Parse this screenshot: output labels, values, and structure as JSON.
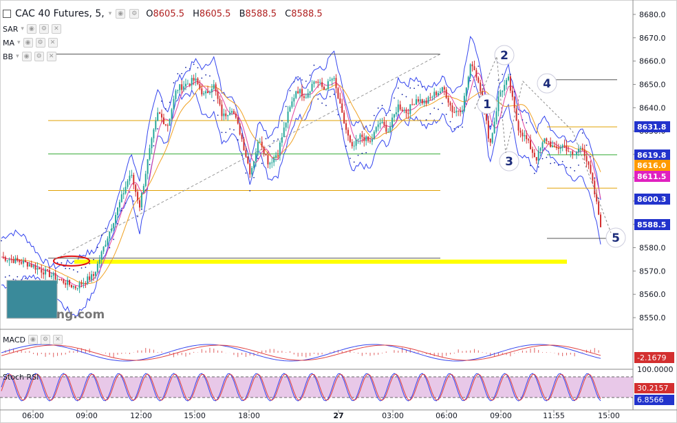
{
  "legend": {
    "title": "CAC 40 Futures, 5,",
    "o_label": "O",
    "o": "8605.5",
    "h_label": "H",
    "h": "8605.5",
    "l_label": "B",
    "l": "8588.5",
    "c_label": "C",
    "c": "8588.5"
  },
  "indicators": [
    "SAR",
    "MA",
    "BB"
  ],
  "panes": {
    "macd_label": "MACD",
    "stoch_label": "Stoch RSI"
  },
  "watermark": "ng.com",
  "colors": {
    "bull": "#26a69a",
    "bear": "#d32f2f",
    "bb": "#3344ee",
    "ma_fast": "#e040a0",
    "ma_slow": "#f0a020",
    "level_orange": "#e0a000",
    "level_green": "#33aa33",
    "highlight": "#ffff00",
    "stoch_fill": "#e8c8e8"
  },
  "chart_data": {
    "type": "candlestick",
    "title": "CAC 40 Futures, 5,",
    "ylim": [
      8545,
      8685
    ],
    "y_ticks": [
      8550.0,
      8560.0,
      8570.0,
      8580.0,
      8590.0,
      8600.0,
      8610.0,
      8620.0,
      8630.0,
      8640.0,
      8650.0,
      8660.0,
      8670.0,
      8680.0
    ],
    "x_ticks": [
      "06:00",
      "09:00",
      "12:00",
      "15:00",
      "18:00",
      "27",
      "03:00",
      "06:00",
      "09:00",
      "11:55",
      "15:00"
    ],
    "price_series": [
      [
        0,
        8576
      ],
      [
        3,
        8573
      ],
      [
        6,
        8567
      ],
      [
        8,
        8563
      ],
      [
        10,
        8568
      ],
      [
        12,
        8590
      ],
      [
        14,
        8612
      ],
      [
        15,
        8598
      ],
      [
        16,
        8620
      ],
      [
        17,
        8638
      ],
      [
        18,
        8632
      ],
      [
        19,
        8648
      ],
      [
        21,
        8652
      ],
      [
        22,
        8645
      ],
      [
        23,
        8650
      ],
      [
        24,
        8636
      ],
      [
        25,
        8640
      ],
      [
        26,
        8628
      ],
      [
        27,
        8612
      ],
      [
        28,
        8627
      ],
      [
        29,
        8616
      ],
      [
        30,
        8621
      ],
      [
        31,
        8636
      ],
      [
        32,
        8648
      ],
      [
        33,
        8645
      ],
      [
        34,
        8652
      ],
      [
        35,
        8648
      ],
      [
        36,
        8653
      ],
      [
        37,
        8636
      ],
      [
        38,
        8622
      ],
      [
        39,
        8628
      ],
      [
        40,
        8625
      ],
      [
        41,
        8634
      ],
      [
        42,
        8630
      ],
      [
        43,
        8641
      ],
      [
        44,
        8638
      ],
      [
        45,
        8644
      ],
      [
        46,
        8642
      ],
      [
        47,
        8646
      ],
      [
        48,
        8648
      ],
      [
        49,
        8638
      ],
      [
        50,
        8640
      ],
      [
        51,
        8660
      ],
      [
        52,
        8648
      ],
      [
        53,
        8624
      ],
      [
        54,
        8646
      ],
      [
        55,
        8652
      ],
      [
        56,
        8632
      ],
      [
        57,
        8626
      ],
      [
        58,
        8618
      ],
      [
        59,
        8627
      ],
      [
        60,
        8622
      ],
      [
        61,
        8624
      ],
      [
        62,
        8619
      ],
      [
        63,
        8624
      ],
      [
        64,
        8610
      ],
      [
        65,
        8590
      ]
    ],
    "levels_orange": [
      8634.5,
      8604.5,
      8631.8,
      8605.5
    ],
    "levels_green": [
      8620.2,
      8619.8
    ],
    "support_zone": 8574.0,
    "wave_labels": [
      "1",
      "2",
      "3",
      "4",
      "5"
    ],
    "price_labels": [
      {
        "value": "8631.8",
        "color": "#2233cc"
      },
      {
        "value": "8619.8",
        "color": "#2233cc"
      },
      {
        "value": "8616.0",
        "color": "#ff9a00"
      },
      {
        "value": "8611.5",
        "color": "#e020c0"
      },
      {
        "value": "8600.3",
        "color": "#2233cc"
      },
      {
        "value": "8588.5",
        "color": "#2233cc"
      }
    ],
    "macd": {
      "label": "MACD",
      "last_value": "-2.1679"
    },
    "stoch_rsi": {
      "label": "Stoch RSI",
      "values": [
        "100.0000",
        "30.2157",
        "6.8566"
      ],
      "value_colors": [
        "#131722",
        "#d32f2f",
        "#2233cc"
      ]
    }
  }
}
